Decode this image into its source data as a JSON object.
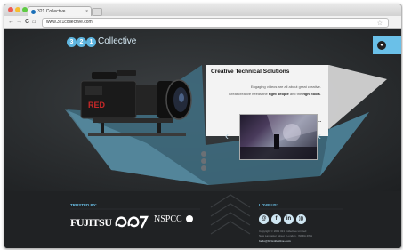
{
  "browser": {
    "tab_title": "321 Collective",
    "tab_close": "×",
    "url": "www.321collective.com",
    "back": "←",
    "forward": "→",
    "reload": "C",
    "home": "⌂",
    "star": "☆"
  },
  "site": {
    "logo_digits": [
      "3",
      "2",
      "1"
    ],
    "logo_word": "Collective",
    "menu_icon": "menu-circle-icon"
  },
  "hero": {
    "heading": "Creative Technical Solutions",
    "line1": "Engaging videos are all about great creative.",
    "line2_start": "Great creative needs the ",
    "line2_bold1": "right people",
    "line2_mid": " and the ",
    "line2_bold2": "right tools",
    "line2_end": ".",
    "tagline": "That's where we come in..."
  },
  "footer": {
    "trusted_by": "TRUSTED BY:",
    "clients": [
      "FUJITSU",
      "NSPCC"
    ],
    "love_us": "LOVE US:",
    "social_icons": [
      "email-icon",
      "facebook-icon",
      "linkedin-icon",
      "rss-icon"
    ],
    "copyright": "Copyright © 2011 321 Collective Limited",
    "address": "New Lancaster Street · London · W1DA 4WH",
    "email": "hello@321collective.com"
  },
  "colors": {
    "accent": "#6ac0e8",
    "background": "#2d3032",
    "footer": "#202224"
  }
}
